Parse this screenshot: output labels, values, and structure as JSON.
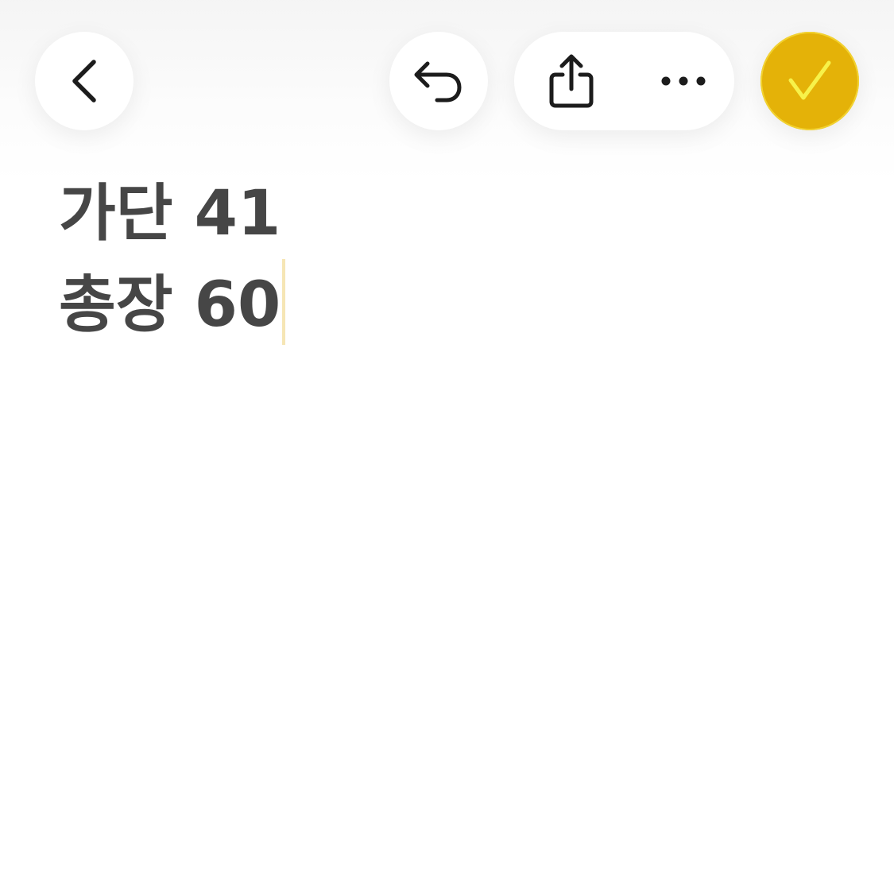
{
  "colors": {
    "accent": "#E4B208",
    "checkmark": "#F7F24A",
    "text": "#464646",
    "icon": "#1C1C1C",
    "caret": "#F6E6B5"
  },
  "toolbar": {
    "back_icon": "chevron-left-icon",
    "undo_icon": "undo-arrow-icon",
    "share_icon": "share-icon",
    "more_icon": "ellipsis-icon",
    "done_icon": "checkmark-icon"
  },
  "note": {
    "lines": [
      "가단 41",
      "총장 60"
    ]
  }
}
